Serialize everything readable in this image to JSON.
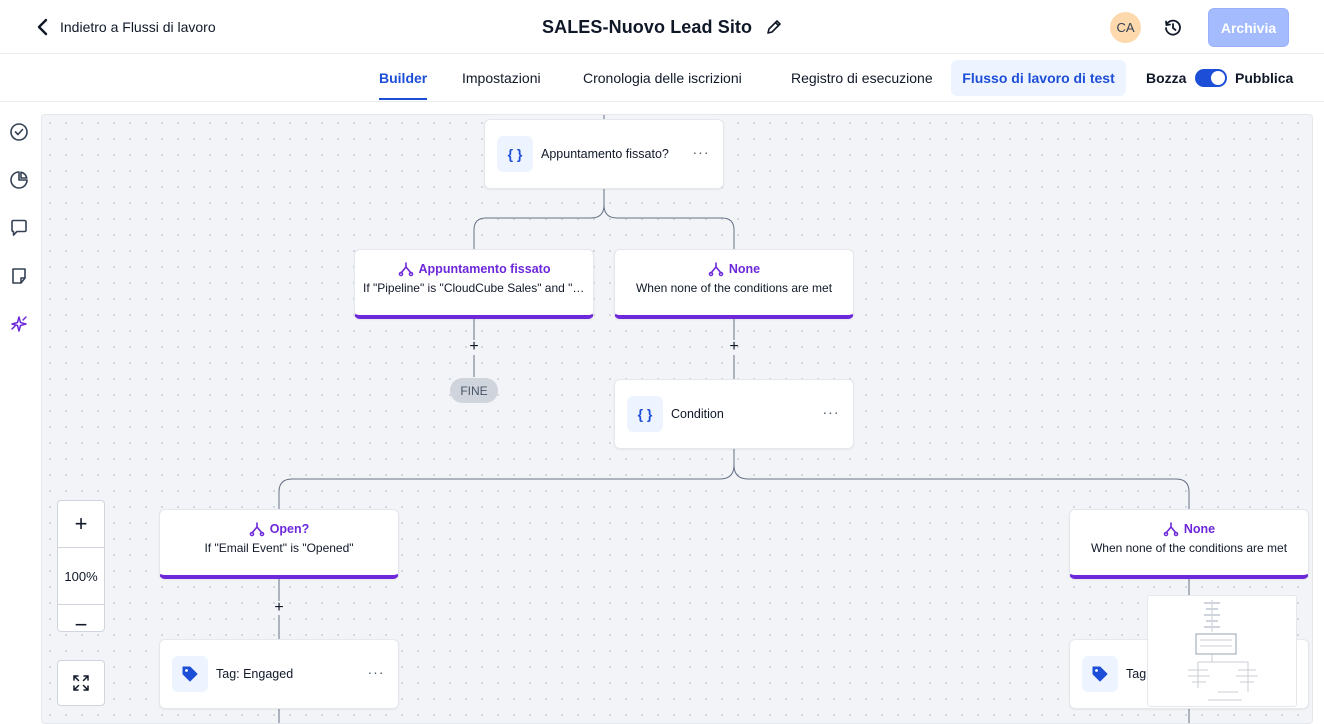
{
  "header": {
    "back_label": "Indietro a Flussi di lavoro",
    "title": "SALES-Nuovo Lead Sito",
    "avatar_initials": "CA",
    "archive_label": "Archivia"
  },
  "tabs": [
    {
      "label": "Builder",
      "active": true
    },
    {
      "label": "Impostazioni"
    },
    {
      "label": "Cronologia delle iscrizioni"
    },
    {
      "label": "Registro di esecuzione"
    }
  ],
  "test_button": "Flusso di lavoro di test",
  "toggle": {
    "left_label": "Bozza",
    "right_label": "Pubblica",
    "state": "on"
  },
  "nodes": {
    "appointment_check": {
      "label": "Appuntamento fissato?",
      "icon": "curly-braces-icon",
      "menu": "···"
    },
    "branch_appointment": {
      "title": "Appuntamento fissato",
      "subtitle": "If \"Pipeline\" is \"CloudCube Sales\" and \"Pipeline Stage\" is \"Appuntamento\""
    },
    "branch_none_1": {
      "title": "None",
      "subtitle": "When none of the conditions are met"
    },
    "end_label": "FINE",
    "condition": {
      "label": "Condition",
      "icon": "curly-braces-icon",
      "menu": "···"
    },
    "branch_open": {
      "title": "Open?",
      "subtitle": "If \"Email Event\" is \"Opened\""
    },
    "branch_none_2": {
      "title": "None",
      "subtitle": "When none of the conditions are met"
    },
    "tag_engaged": {
      "label": "Tag: Engaged",
      "icon": "tag-icon",
      "menu": "···"
    },
    "tag_partial": {
      "label": "Tag",
      "icon": "tag-icon"
    }
  },
  "zoom": {
    "level": "100%",
    "plus": "+",
    "minus": "−"
  },
  "colors": {
    "accent": "#1d4ed8",
    "branch": "#6d28d9",
    "archive_bg": "#a4bcfd"
  }
}
